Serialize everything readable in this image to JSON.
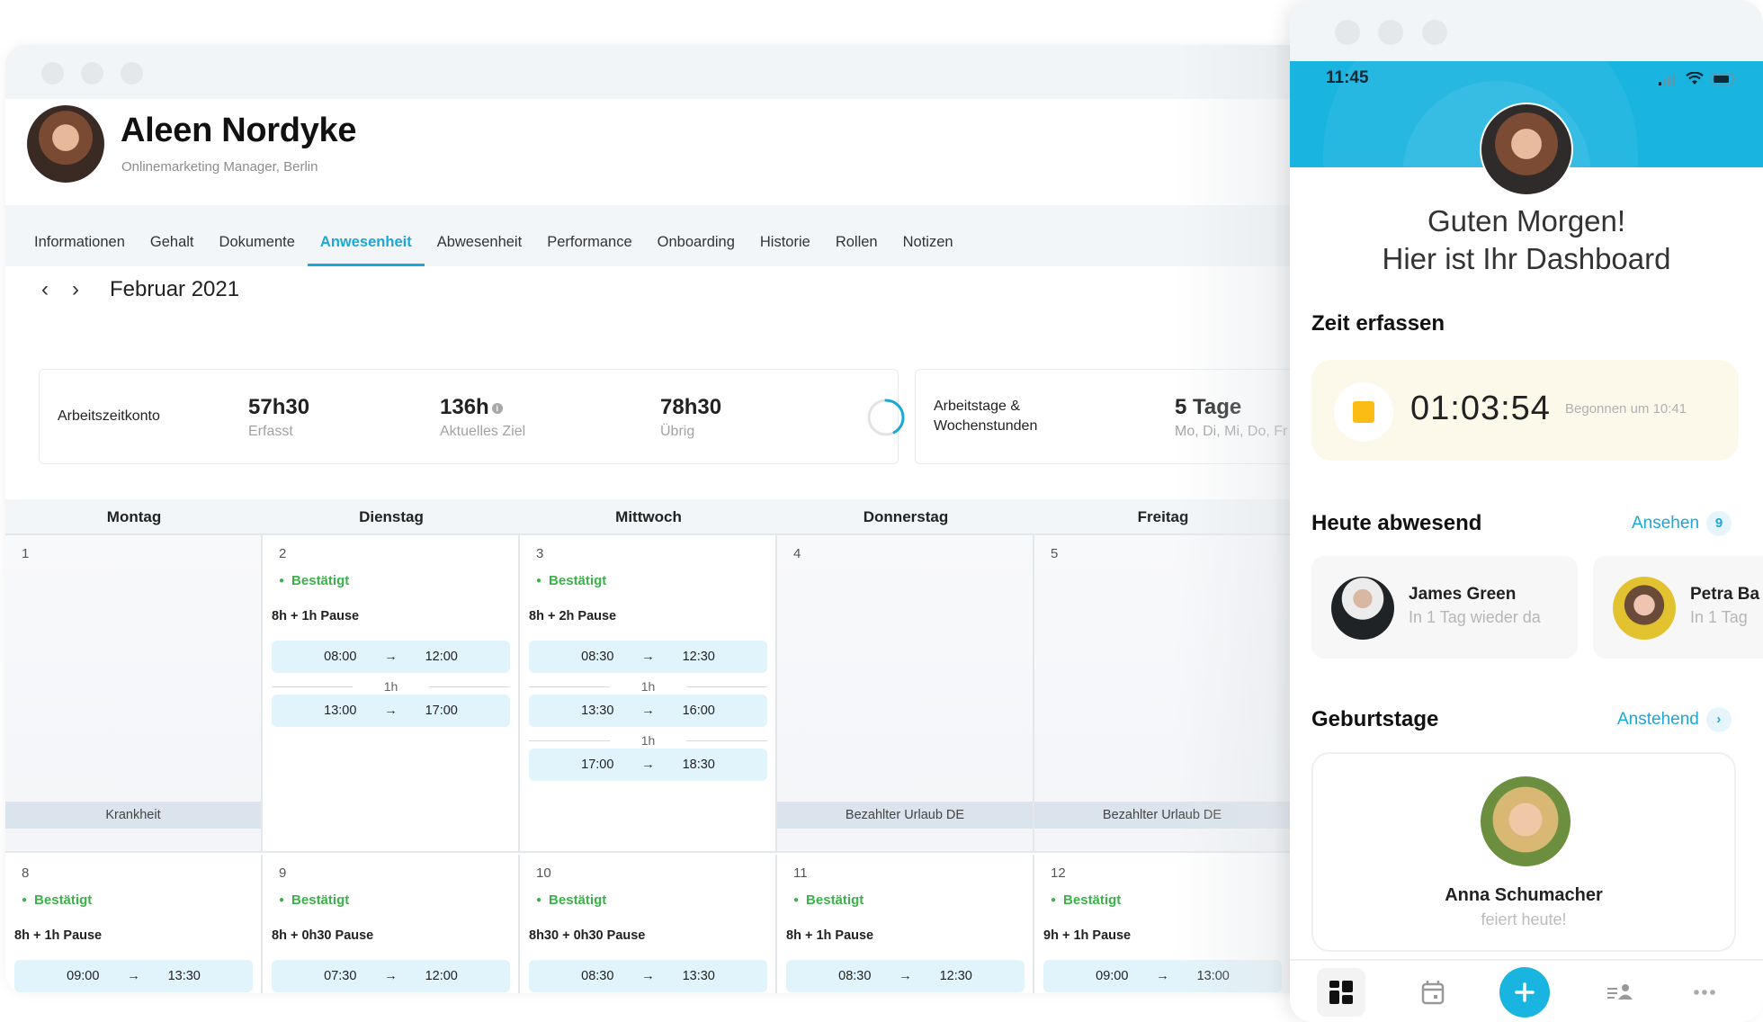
{
  "desktop": {
    "profile": {
      "name": "Aleen Nordyke",
      "subtitle": "Onlinemarketing Manager, Berlin"
    },
    "tabs": [
      {
        "label": "Informationen",
        "active": false
      },
      {
        "label": "Gehalt",
        "active": false
      },
      {
        "label": "Dokumente",
        "active": false
      },
      {
        "label": "Anwesenheit",
        "active": true
      },
      {
        "label": "Abwesenheit",
        "active": false
      },
      {
        "label": "Performance",
        "active": false
      },
      {
        "label": "Onboarding",
        "active": false
      },
      {
        "label": "Historie",
        "active": false
      },
      {
        "label": "Rollen",
        "active": false
      },
      {
        "label": "Notizen",
        "active": false
      }
    ],
    "month": {
      "prev_icon": "chevron-left-icon",
      "next_icon": "chevron-right-icon",
      "label": "Februar 2021"
    },
    "worktime_account": {
      "label": "Arbeitszeitkonto",
      "stats": [
        {
          "value": "57h30",
          "label": "Erfasst"
        },
        {
          "value": "136h",
          "label": "Aktuelles Ziel",
          "info_icon": "i"
        },
        {
          "value": "78h30",
          "label": "Übrig"
        }
      ],
      "progress_fraction": 0.42
    },
    "workdays": {
      "label_line1": "Arbeitstage &",
      "label_line2": "Wochenstunden",
      "value": "5 Tage",
      "sub": "Mo, Di, Mi, Do, Fr"
    },
    "calendar": {
      "weekdays": [
        "Montag",
        "Dienstag",
        "Mittwoch",
        "Donnerstag",
        "Freitag"
      ],
      "weeks": [
        [
          {
            "day": "1",
            "absence": "Krankheit"
          },
          {
            "day": "2",
            "status": "Bestätigt",
            "duration": "8h + 1h Pause",
            "slots": [
              {
                "start": "08:00",
                "end": "12:00"
              },
              {
                "start": "13:00",
                "end": "17:00"
              }
            ],
            "gaps": [
              "1h"
            ]
          },
          {
            "day": "3",
            "status": "Bestätigt",
            "duration": "8h + 2h Pause",
            "slots": [
              {
                "start": "08:30",
                "end": "12:30"
              },
              {
                "start": "13:30",
                "end": "16:00"
              },
              {
                "start": "17:00",
                "end": "18:30"
              }
            ],
            "gaps": [
              "1h",
              "1h"
            ]
          },
          {
            "day": "4",
            "absence": "Bezahlter Urlaub DE"
          },
          {
            "day": "5",
            "absence": "Bezahlter Urlaub DE"
          }
        ],
        [
          {
            "day": "8",
            "status": "Bestätigt",
            "duration": "8h + 1h Pause",
            "slots": [
              {
                "start": "09:00",
                "end": "13:30"
              }
            ]
          },
          {
            "day": "9",
            "status": "Bestätigt",
            "duration": "8h + 0h30 Pause",
            "slots": [
              {
                "start": "07:30",
                "end": "12:00"
              }
            ]
          },
          {
            "day": "10",
            "status": "Bestätigt",
            "duration": "8h30 + 0h30 Pause",
            "slots": [
              {
                "start": "08:30",
                "end": "13:30"
              }
            ]
          },
          {
            "day": "11",
            "status": "Bestätigt",
            "duration": "8h + 1h Pause",
            "slots": [
              {
                "start": "08:30",
                "end": "12:30"
              }
            ]
          },
          {
            "day": "12",
            "status": "Bestätigt",
            "duration": "9h + 1h Pause",
            "slots": [
              {
                "start": "09:00",
                "end": "13:00"
              }
            ]
          }
        ]
      ],
      "arrow": "→"
    }
  },
  "phone": {
    "status_time": "11:45",
    "greeting_line1": "Guten Morgen!",
    "greeting_line2": "Hier ist Ihr Dashboard",
    "time_tracking": {
      "title": "Zeit erfassen",
      "timer": "01:03:54",
      "started": "Begonnen um 10:41"
    },
    "absent_today": {
      "title": "Heute abwesend",
      "link": "Ansehen",
      "count": "9",
      "people": [
        {
          "name": "James Green",
          "status": "In 1 Tag wieder da"
        },
        {
          "name": "Petra Ba",
          "status": "In 1 Tag"
        }
      ]
    },
    "birthdays": {
      "title": "Geburtstage",
      "link": "Anstehend",
      "person": {
        "name": "Anna Schumacher",
        "status": "feiert heute!"
      }
    },
    "bottom_nav": [
      "dashboard-icon",
      "calendar-icon",
      "plus-icon",
      "team-icon",
      "more-icon"
    ],
    "colors": {
      "accent": "#1ab4e0",
      "confirmed": "#3cb14a",
      "stop": "#fbbd14"
    }
  }
}
